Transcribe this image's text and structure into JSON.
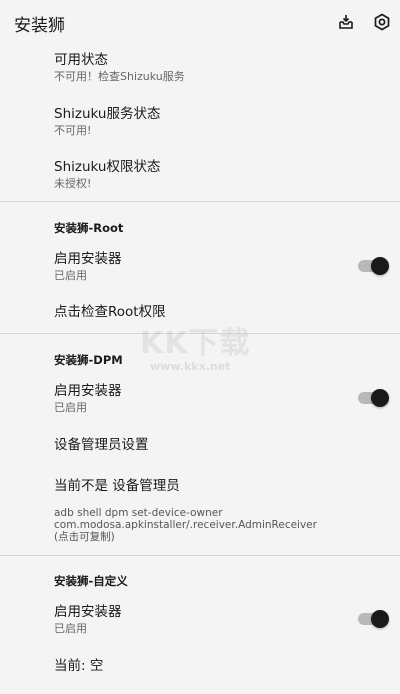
{
  "appbar": {
    "title": "安装狮"
  },
  "prefs": {
    "usable": {
      "title": "可用状态",
      "summary": "不可用！检查Shizuku服务"
    },
    "shizuku_service": {
      "title": "Shizuku服务状态",
      "summary": "不可用!"
    },
    "shizuku_permission": {
      "title": "Shizuku权限状态",
      "summary": "未授权!"
    }
  },
  "root": {
    "category": "安装狮-Root",
    "enable": {
      "title": "启用安装器",
      "summary": "已启用",
      "on": true
    },
    "check": {
      "title": "点击检查Root权限"
    }
  },
  "dpm": {
    "category": "安装狮-DPM",
    "enable": {
      "title": "启用安装器",
      "summary": "已启用",
      "on": true
    },
    "admin_settings": {
      "title": "设备管理员设置"
    },
    "current": {
      "title": "当前不是 设备管理员"
    },
    "adb_lines": [
      "adb shell dpm set-device-owner",
      "com.modosa.apkinstaller/.receiver.AdminReceiver",
      "(点击可复制)"
    ]
  },
  "custom": {
    "category": "安装狮-自定义",
    "enable": {
      "title": "启用安装器",
      "summary": "已启用",
      "on": true
    },
    "current": {
      "title": "当前: 空"
    }
  },
  "watermark": {
    "main": "KK下载",
    "sub": "www.kkx.net"
  }
}
